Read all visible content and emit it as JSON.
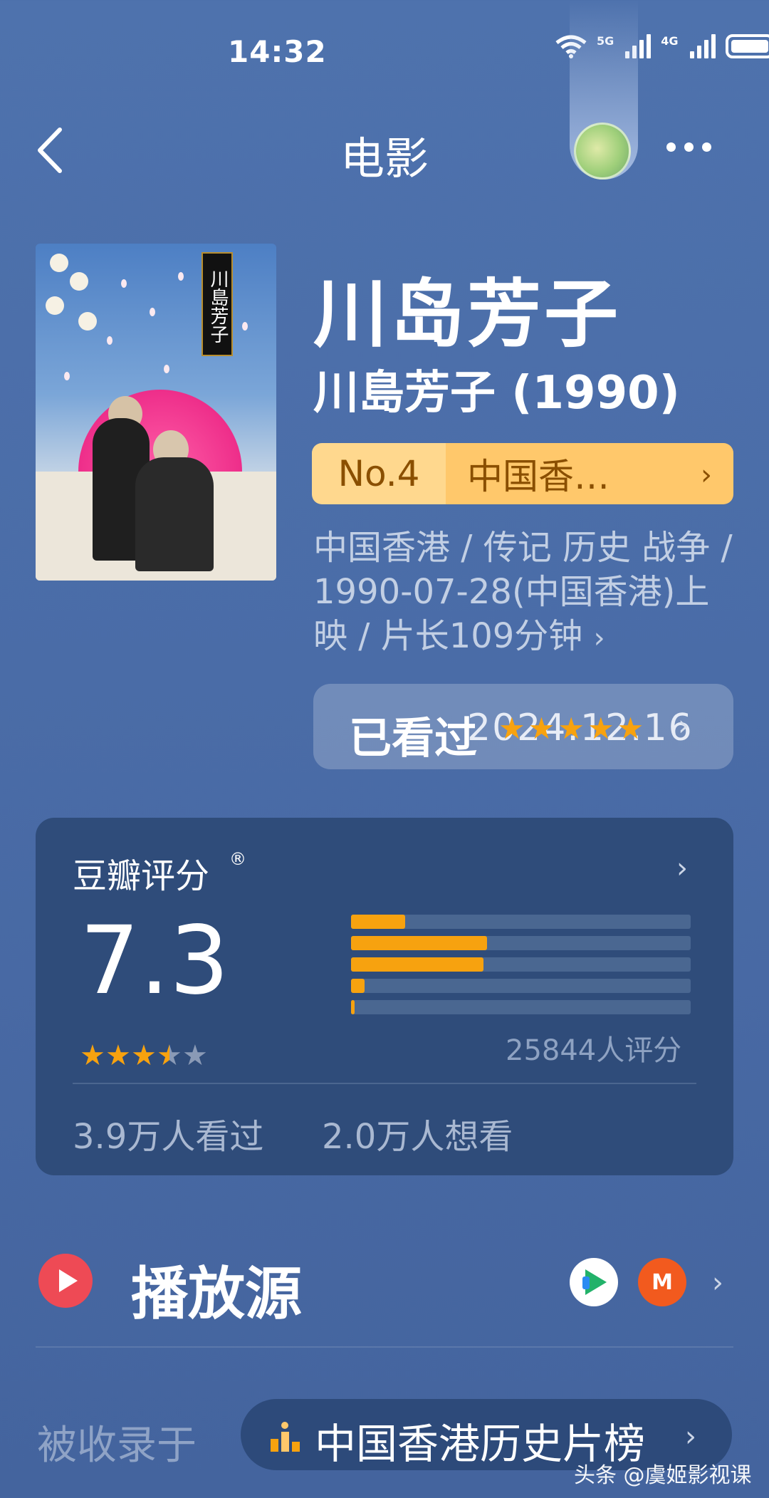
{
  "status_bar": {
    "time": "14:32",
    "network1": "5G",
    "network2": "4G"
  },
  "nav": {
    "title": "电影"
  },
  "movie": {
    "title": "川岛芳子",
    "original_title": "川島芳子 (1990)",
    "poster_vertical_text": "川島芳子",
    "rank_no": "No.4",
    "rank_label": "中国香…",
    "meta": "中国香港 / 传记 历史 战争 / 1990-07-28(中国香港)上映 / 片长109分钟"
  },
  "watched": {
    "label": "已看过",
    "date": "2024.12.16",
    "stars": 5
  },
  "rating": {
    "title": "豆瓣评分",
    "reg": "®",
    "score": "7.3",
    "stars": 3.5,
    "count": "25844人评分",
    "distribution": [
      {
        "stars": "★★★★★",
        "fraction": 0.16
      },
      {
        "stars": "★★★★",
        "fraction": 0.4
      },
      {
        "stars": "★★★",
        "fraction": 0.39
      },
      {
        "stars": "★★",
        "fraction": 0.04
      },
      {
        "stars": "★",
        "fraction": 0.01
      }
    ],
    "seen": "3.9万人看过",
    "want": "2.0万人想看"
  },
  "source": {
    "title": "播放源",
    "providers": [
      "tencent-video-icon",
      "mango-tv-icon"
    ]
  },
  "collection": {
    "label": "被收录于",
    "name": "中国香港历史片榜"
  },
  "watermark": "头条 @虞姬影视课",
  "colors": {
    "background": "#4a6ca7",
    "card": "#2f4c7a",
    "accent_orange": "#f7a20f",
    "rank_bg": "#ffc86b"
  }
}
